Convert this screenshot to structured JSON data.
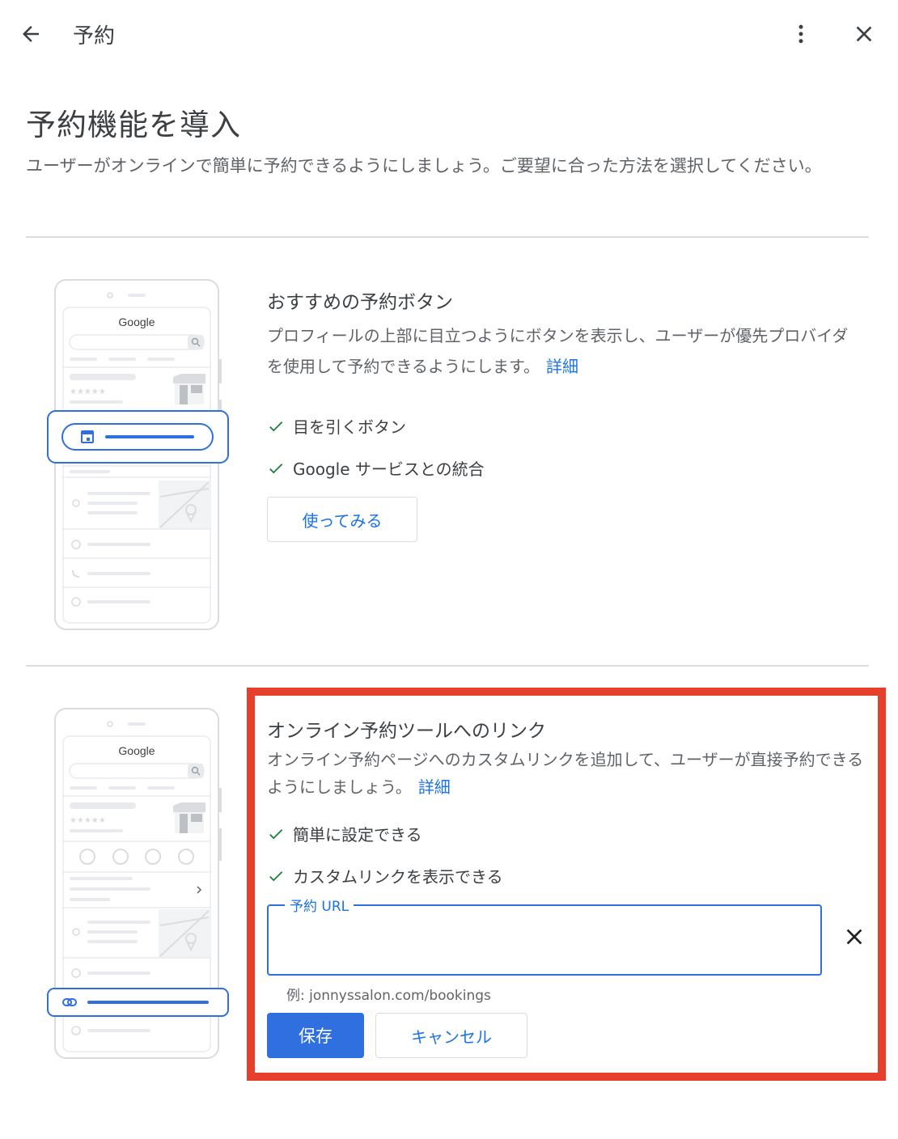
{
  "header": {
    "title": "予約"
  },
  "intro": {
    "title": "予約機能を導入",
    "description": "ユーザーがオンラインで簡単に予約できるようにしましょう。ご要望に合った方法を選択してください。"
  },
  "mockup": {
    "logo": "Google",
    "stars": "★★★★★"
  },
  "option1": {
    "title": "おすすめの予約ボタン",
    "description": "プロフィールの上部に目立つようにボタンを表示し、ユーザーが優先プロバイダを使用して予約できるようにします。",
    "learn_more": "詳細",
    "features": [
      "目を引くボタン",
      "Google サービスとの統合"
    ],
    "try_button": "使ってみる"
  },
  "option2": {
    "title": "オンライン予約ツールへのリンク",
    "description": "オンライン予約ページへのカスタムリンクを追加して、ユーザーが直接予約できるようにしましょう。",
    "learn_more": "詳細",
    "features": [
      "簡単に設定できる",
      "カスタムリンクを表示できる"
    ],
    "url_field": {
      "label": "予約 URL",
      "value": "",
      "hint": "例: jonnyssalon.com/bookings"
    },
    "save_button": "保存",
    "cancel_button": "キャンセル"
  },
  "colors": {
    "accent": "#1a73e8",
    "primary_button": "#2f6fdf",
    "highlight_border": "#e63f2b",
    "check": "#188038"
  },
  "icons": [
    "back-arrow-icon",
    "more-vert-icon",
    "close-icon",
    "check-icon",
    "calendar-icon",
    "link-icon",
    "search-icon",
    "store-icon",
    "pin-icon",
    "clock-icon",
    "phone-icon",
    "globe-icon",
    "call-icon",
    "directions-icon",
    "save-icon",
    "chevron-right-icon"
  ]
}
